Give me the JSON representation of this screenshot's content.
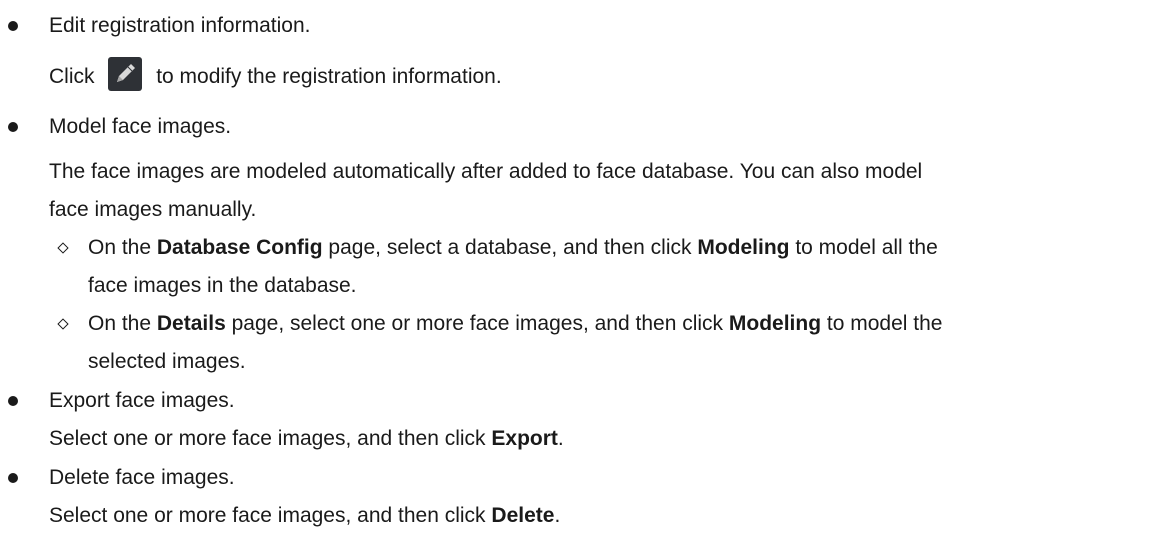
{
  "items": [
    {
      "title": "Edit registration information.",
      "desc_prefix": "Click",
      "desc_icon": "pencil-icon",
      "desc_suffix": "to modify the registration information."
    },
    {
      "title": "Model face images.",
      "desc_line1": "The face images are modeled automatically after added to face database. You can also model",
      "desc_line2": "face images manually.",
      "subitems": [
        {
          "t1": "On the ",
          "b1": "Database Config",
          "t2": " page, select a database, and then click ",
          "b2": "Modeling",
          "t3": " to model all the",
          "cont": "face images in the database."
        },
        {
          "t1": "On the ",
          "b1": "Details",
          "t2": " page, select one or more face images, and then click ",
          "b2": "Modeling",
          "t3": " to model the",
          "cont": "selected images."
        }
      ]
    },
    {
      "title": "Export face images.",
      "desc_text": "Select one or more face images, and then click ",
      "desc_bold": "Export",
      "desc_end": "."
    },
    {
      "title": "Delete face images.",
      "desc_text": "Select one or more face images, and then click ",
      "desc_bold": "Delete",
      "desc_end": "."
    }
  ],
  "colors": {
    "text": "#1a1a1a",
    "icon_bg": "#2e3136",
    "icon_fg": "#d9d9d9"
  }
}
